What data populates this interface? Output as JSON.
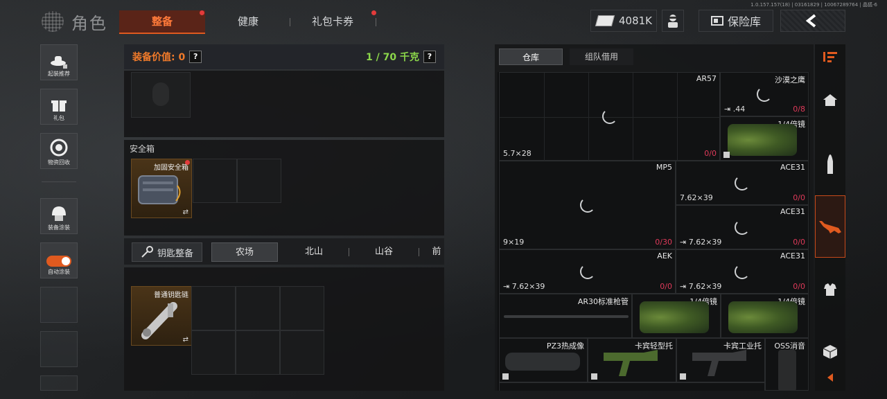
{
  "version": "1.0.157.157(18) | 03161829 | 10067289764 | 晶狐-6",
  "header": {
    "title": "角色",
    "tabs": [
      {
        "label": "整备",
        "active": true,
        "badge": true
      },
      {
        "label": "健康",
        "active": false,
        "badge": false
      },
      {
        "label": "礼包卡券",
        "active": false,
        "badge": true
      }
    ],
    "money": "4081K",
    "insurance_label": "保险库"
  },
  "sidebar": {
    "items": [
      {
        "label": "起装推荐",
        "icon": "cowboy-hat-icon"
      },
      {
        "label": "礼包",
        "icon": "gift-icon"
      },
      {
        "label": "物资回收",
        "icon": "recycle-icon"
      },
      {
        "label": "装备涂装",
        "icon": "helmet-icon"
      },
      {
        "label": "自动涂装",
        "icon": "toggle-icon"
      }
    ]
  },
  "equipment": {
    "value_label": "装备价值: 0",
    "weight_label": "1 / 70 千克",
    "safebox_title": "安全箱",
    "safebox_item": "加固安全箱",
    "key_button": "钥匙整备",
    "key_tabs": [
      "农场",
      "北山",
      "山谷",
      "前"
    ],
    "key_item": "普通钥匙链"
  },
  "warehouse": {
    "tabs": [
      "仓库",
      "组队借用"
    ],
    "cells": {
      "c1": {
        "name": "AR57",
        "caliber": "5.7×28",
        "count": "0/0"
      },
      "c2": {
        "name": "沙漠之鹰",
        "caliber": ".44",
        "count": "0/8"
      },
      "c3": {
        "name": "1/4倍镜"
      },
      "c4": {
        "name": "MP5",
        "caliber": "9×19",
        "count": "0/30"
      },
      "c5": {
        "name": "ACE31",
        "caliber": "7.62×39",
        "count": "0/0"
      },
      "c6": {
        "name": "ACE31",
        "caliber": "7.62×39",
        "count": "0/0"
      },
      "c7": {
        "name": "AEK",
        "caliber": "7.62×39",
        "count": "0/0"
      },
      "c8": {
        "name": "ACE31",
        "caliber": "7.62×39",
        "count": "0/0"
      },
      "c9": {
        "name": "AR30标准枪管"
      },
      "c10": {
        "name": "1/4倍镜"
      },
      "c11": {
        "name": "1/4倍镜"
      },
      "c12": {
        "name": "PZ3热成像"
      },
      "c13": {
        "name": "卡宾轻型托"
      },
      "c14": {
        "name": "卡宾工业托"
      },
      "c15": {
        "name": "OSS消音"
      }
    }
  },
  "colors": {
    "accent_orange": "#e05a1f",
    "value_orange": "#f07a2a",
    "weight_green": "#8bd64a",
    "count_red": "#e03a5a"
  }
}
